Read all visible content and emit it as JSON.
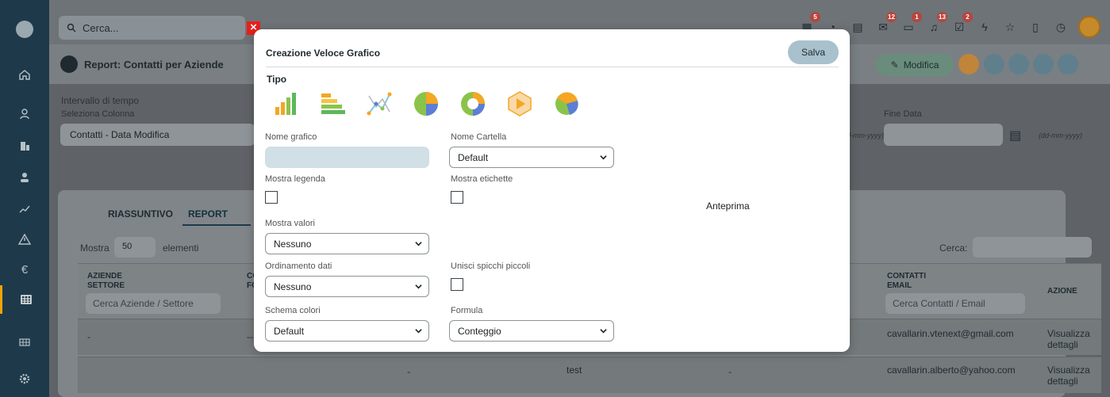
{
  "topbar": {
    "search_placeholder": "Cerca...",
    "badges": [
      "5",
      "12",
      "1",
      "13",
      "2"
    ]
  },
  "page": {
    "title": "Report: Contatti per Aziende",
    "modify_label": "Modifica"
  },
  "filters": {
    "interval_label": "Intervallo di tempo",
    "column_label": "Seleziona Colonna",
    "column_value": "Contatti - Data Modifica",
    "end_label": "Fine Data",
    "date_format_1": "(dd-mm-yyyy)",
    "date_format_2": "(dd-mm-yyyy)"
  },
  "report": {
    "tab_summary": "RIASSUNTIVO",
    "tab_report": "REPORT",
    "show_label": "Mostra",
    "show_value": "50",
    "elements_label": "elementi",
    "search_label": "Cerca:",
    "col1_line1": "AZIENDE",
    "col1_line2": "SETTORE",
    "col1_placeholder": "Cerca Aziende / Settore",
    "col2_frag": "CO",
    "col2_frag2": "FO",
    "col_email_line1": "CONTATTI",
    "col_email_line2": "EMAIL",
    "col_email_placeholder": "Cerca Contatti / Email",
    "col_action": "AZIONE",
    "rows": [
      {
        "c1": "-",
        "c2": "--",
        "email": "cavallarin.vtenext@gmail.com",
        "action_1": "Visualizza",
        "action_2": "dettagli"
      },
      {
        "c3": "-",
        "c4": "test",
        "c5": "-",
        "email": "cavallarin.alberto@yahoo.com",
        "action_1": "Visualizza",
        "action_2": "dettagli"
      }
    ]
  },
  "modal": {
    "title": "Creazione Veloce Grafico",
    "save_label": "Salva",
    "type_label": "Tipo",
    "chart_types": [
      "bar-vertical-icon",
      "bar-horizontal-icon",
      "line-chart-icon",
      "pie-chart-icon",
      "donut-chart-icon",
      "funnel-chart-icon",
      "pie-3d-chart-icon"
    ],
    "chart_name_label": "Nome grafico",
    "chart_name_value": "",
    "folder_label": "Nome Cartella",
    "folder_value": "Default",
    "legend_label": "Mostra legenda",
    "labels_label": "Mostra etichette",
    "values_label": "Mostra valori",
    "values_value": "Nessuno",
    "order_label": "Ordinamento dati",
    "order_value": "Nessuno",
    "merge_label": "Unisci spicchi piccoli",
    "scheme_label": "Schema colori",
    "scheme_value": "Default",
    "formula_label": "Formula",
    "formula_value": "Conteggio",
    "preview_label": "Anteprima"
  }
}
